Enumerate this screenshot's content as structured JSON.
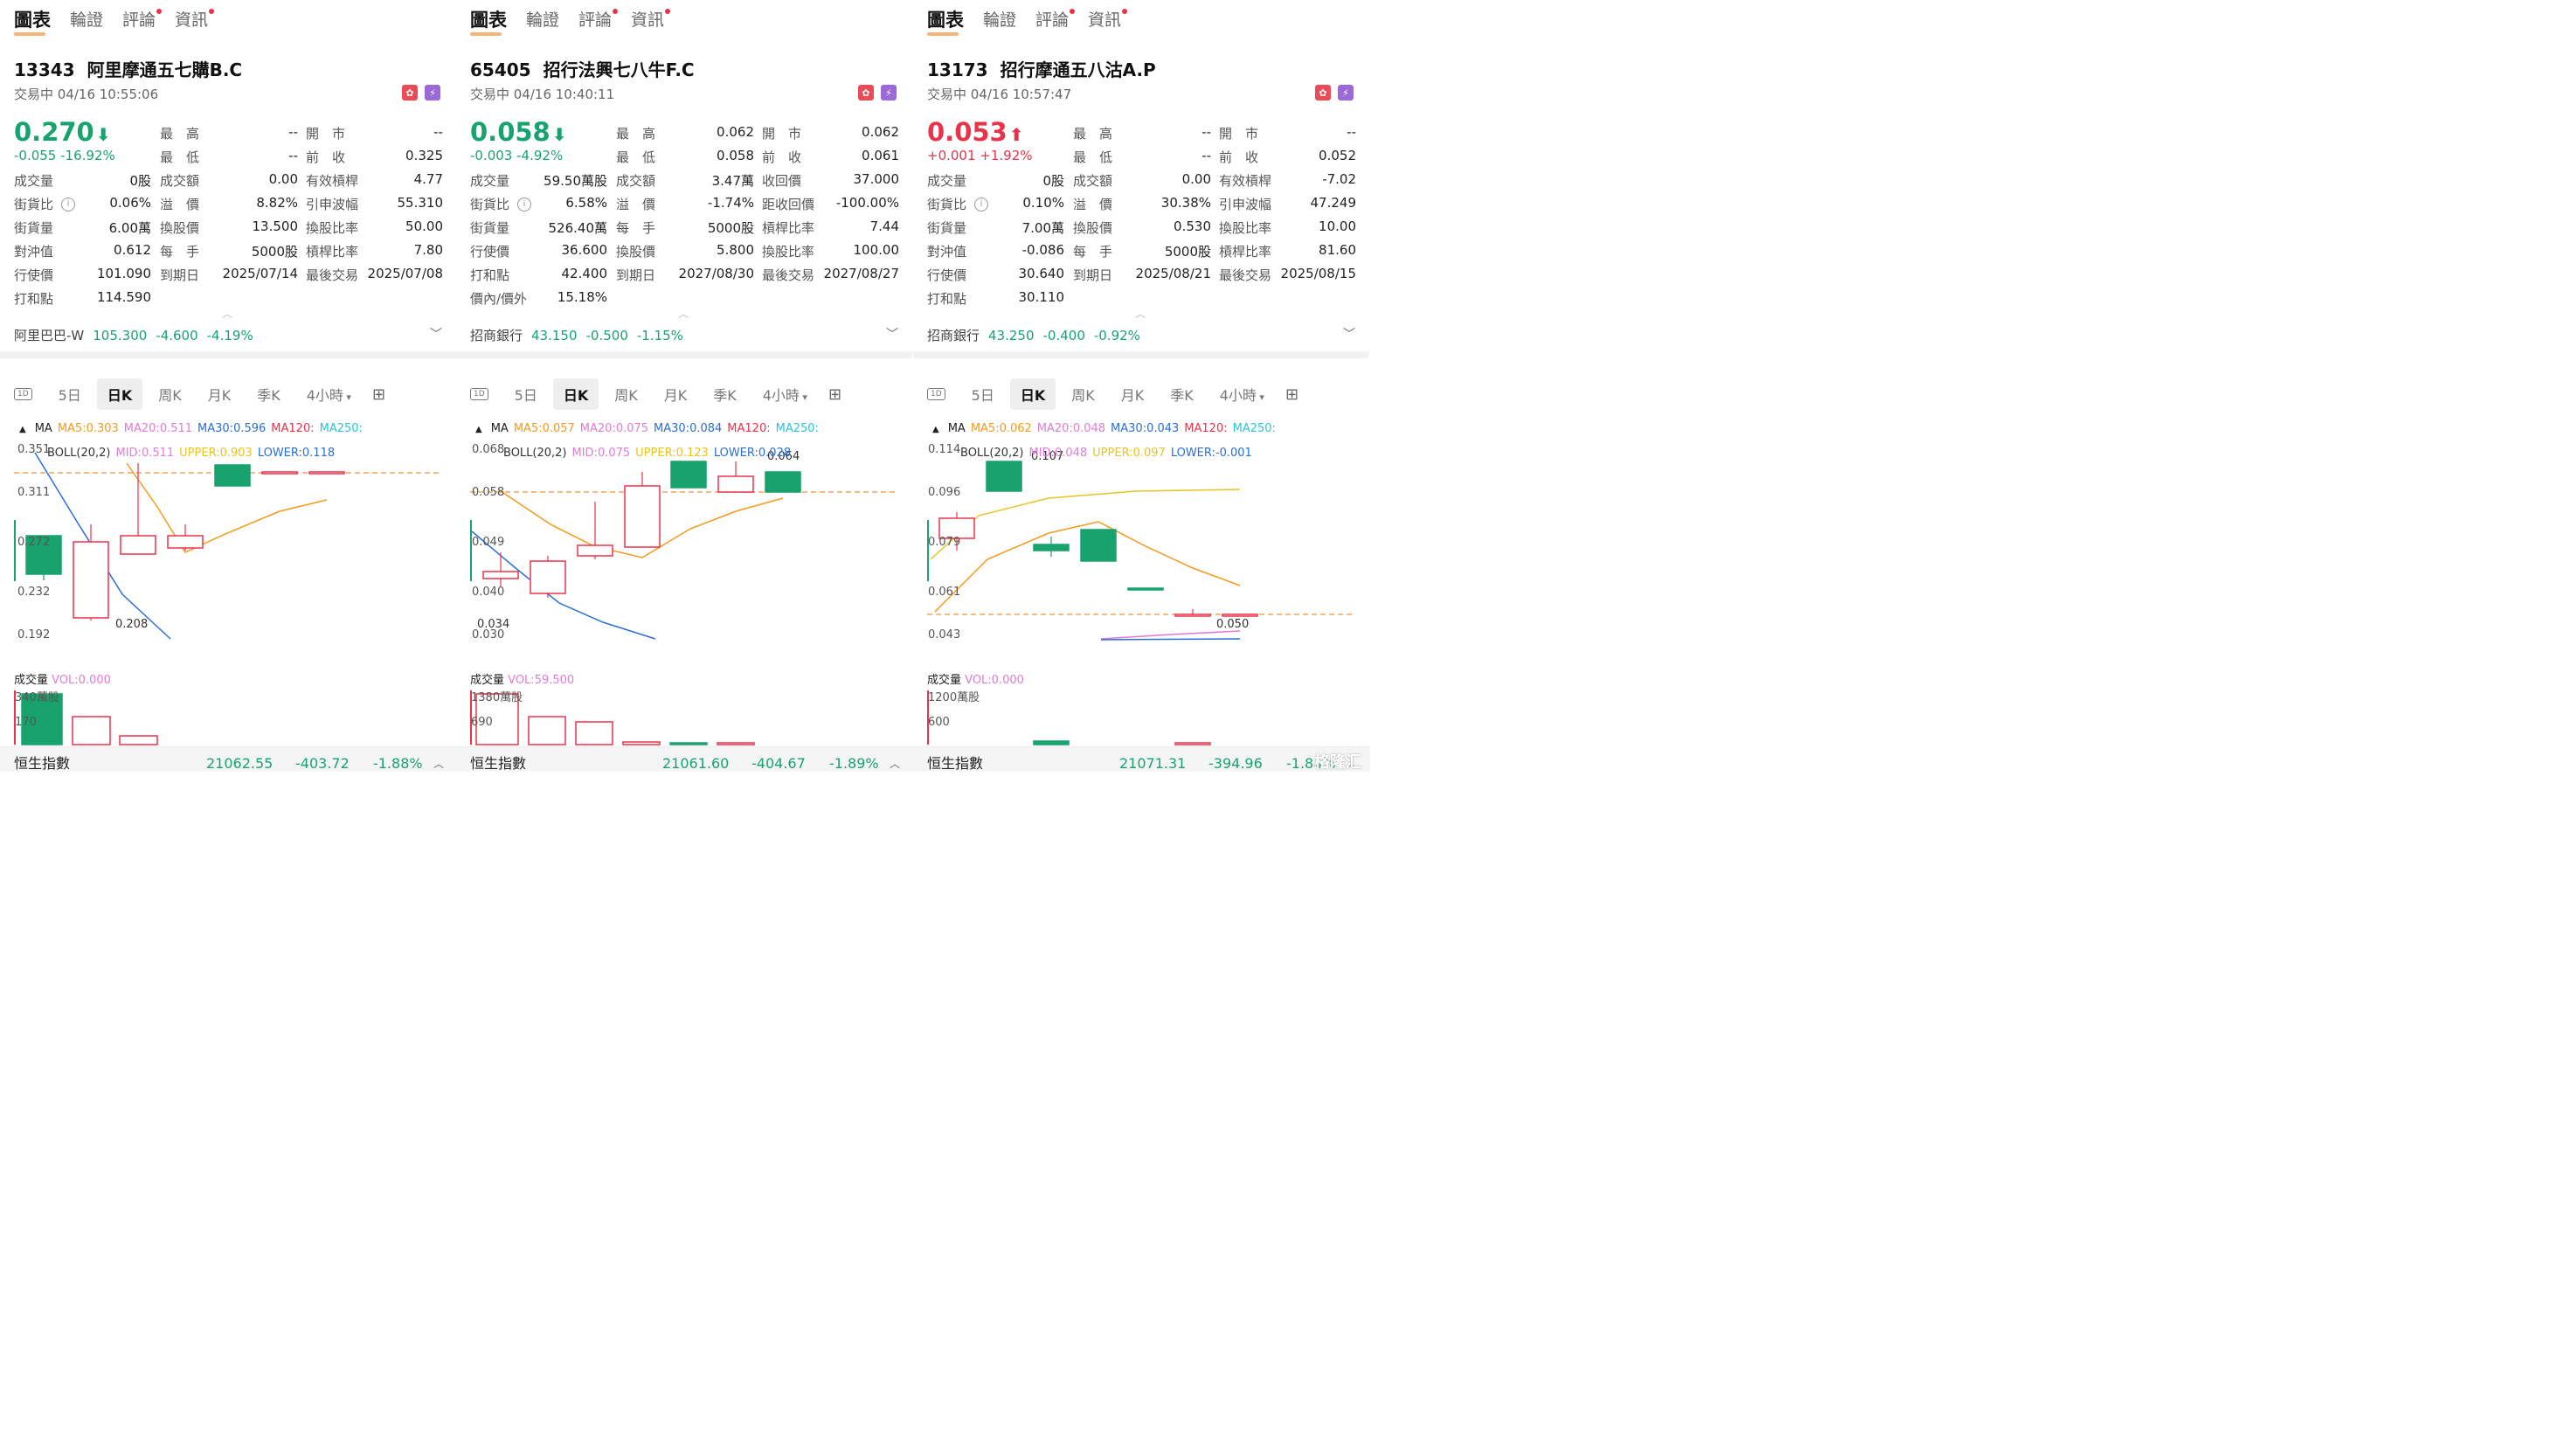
{
  "tabs": [
    "圖表",
    "輪證",
    "評論",
    "資訊"
  ],
  "panels": [
    {
      "code": "13343",
      "name": "阿里摩通五七購B.C",
      "status": "交易中 04/16 10:55:06",
      "price": "0.270",
      "price_arrow": "down",
      "change": "-0.055",
      "change_pct": "-16.92%",
      "trend": "green",
      "quote": [
        {
          "l1": "最　高",
          "v1": "--",
          "l2": "開　市",
          "v2": "--",
          "c1": "",
          "c2": ""
        },
        {
          "l1": "最　低",
          "v1": "--",
          "l2": "前　收",
          "v2": "0.325",
          "c1": "",
          "c2": ""
        },
        {
          "l0": "成交量",
          "v0": "0股",
          "l1": "成交額",
          "v1": "0.00",
          "l2": "有效槓桿",
          "v2": "4.77"
        },
        {
          "l0": "街貨比",
          "v0": "0.06%",
          "l1": "溢　價",
          "v1": "8.82%",
          "l2": "引申波幅",
          "v2": "55.310",
          "info": true
        },
        {
          "l0": "街貨量",
          "v0": "6.00萬",
          "l1": "換股價",
          "v1": "13.500",
          "l2": "換股比率",
          "v2": "50.00"
        },
        {
          "l0": "對沖值",
          "v0": "0.612",
          "l1": "每　手",
          "v1": "5000股",
          "l2": "槓桿比率",
          "v2": "7.80"
        },
        {
          "l0": "行使價",
          "v0": "101.090",
          "l1": "到期日",
          "v1": "2025/07/14",
          "l2": "最後交易",
          "v2": "2025/07/08"
        },
        {
          "l0": "打和點",
          "v0": "114.590",
          "l1": "",
          "v1": "",
          "l2": "",
          "v2": ""
        }
      ],
      "underlying": {
        "name": "阿里巴巴-W",
        "price": "105.300",
        "chg": "-4.600",
        "pct": "-4.19%"
      },
      "ma": {
        "ma5": "MA5:0.303",
        "ma20": "MA20:0.511",
        "ma30": "MA30:0.596",
        "ma120": "MA120:",
        "ma250": "MA250:"
      },
      "boll": {
        "label": "BOLL(20,2)",
        "mid": "MID:0.511",
        "upper": "UPPER:0.903",
        "lower": "LOWER:0.118"
      },
      "yticks": [
        "0.351",
        "0.311",
        "0.272",
        "0.232",
        "0.192"
      ],
      "annot": [
        "0.208"
      ],
      "vol": {
        "label": "成交量",
        "value": "VOL:0.000",
        "t1": "340萬股",
        "t2": "170"
      },
      "footer": {
        "name": "恒生指數",
        "value": "21062.55",
        "chg": "-403.72",
        "pct": "-1.88%"
      }
    },
    {
      "code": "65405",
      "name": "招行法興七八牛F.C",
      "status": "交易中 04/16 10:40:11",
      "price": "0.058",
      "price_arrow": "down",
      "change": "-0.003",
      "change_pct": "-4.92%",
      "trend": "green",
      "quote": [
        {
          "l1": "最　高",
          "v1": "0.062",
          "l2": "開　市",
          "v2": "0.062",
          "c1": "red",
          "c2": "red"
        },
        {
          "l1": "最　低",
          "v1": "0.058",
          "l2": "前　收",
          "v2": "0.061",
          "c1": "green",
          "c2": ""
        },
        {
          "l0": "成交量",
          "v0": "59.50萬股",
          "l1": "成交額",
          "v1": "3.47萬",
          "l2": "收回價",
          "v2": "37.000"
        },
        {
          "l0": "街貨比",
          "v0": "6.58%",
          "l1": "溢　價",
          "v1": "-1.74%",
          "l2": "距收回價",
          "v2": "-100.00%",
          "info": true
        },
        {
          "l0": "街貨量",
          "v0": "526.40萬",
          "l1": "每　手",
          "v1": "5000股",
          "l2": "槓桿比率",
          "v2": "7.44"
        },
        {
          "l0": "行使價",
          "v0": "36.600",
          "l1": "換股價",
          "v1": "5.800",
          "l2": "換股比率",
          "v2": "100.00"
        },
        {
          "l0": "打和點",
          "v0": "42.400",
          "l1": "到期日",
          "v1": "2027/08/30",
          "l2": "最後交易",
          "v2": "2027/08/27"
        },
        {
          "l0": "價內/價外",
          "v0": "15.18%",
          "l1": "",
          "v1": "",
          "l2": "",
          "v2": ""
        }
      ],
      "underlying": {
        "name": "招商銀行",
        "price": "43.150",
        "chg": "-0.500",
        "pct": "-1.15%"
      },
      "ma": {
        "ma5": "MA5:0.057",
        "ma20": "MA20:0.075",
        "ma30": "MA30:0.084",
        "ma120": "MA120:",
        "ma250": "MA250:"
      },
      "boll": {
        "label": "BOLL(20,2)",
        "mid": "MID:0.075",
        "upper": "UPPER:0.123",
        "lower": "LOWER:0.028"
      },
      "yticks": [
        "0.068",
        "0.058",
        "0.049",
        "0.040",
        "0.030"
      ],
      "annot": [
        "0.064",
        "0.034"
      ],
      "vol": {
        "label": "成交量",
        "value": "VOL:59.500",
        "t1": "1380萬股",
        "t2": "690"
      },
      "footer": {
        "name": "恒生指數",
        "value": "21061.60",
        "chg": "-404.67",
        "pct": "-1.89%"
      }
    },
    {
      "code": "13173",
      "name": "招行摩通五八沽A.P",
      "status": "交易中 04/16 10:57:47",
      "price": "0.053",
      "price_arrow": "up",
      "change": "+0.001",
      "change_pct": "+1.92%",
      "trend": "red",
      "quote": [
        {
          "l1": "最　高",
          "v1": "--",
          "l2": "開　市",
          "v2": "--",
          "c1": "",
          "c2": ""
        },
        {
          "l1": "最　低",
          "v1": "--",
          "l2": "前　收",
          "v2": "0.052",
          "c1": "",
          "c2": ""
        },
        {
          "l0": "成交量",
          "v0": "0股",
          "l1": "成交額",
          "v1": "0.00",
          "l2": "有效槓桿",
          "v2": "-7.02"
        },
        {
          "l0": "街貨比",
          "v0": "0.10%",
          "l1": "溢　價",
          "v1": "30.38%",
          "l2": "引申波幅",
          "v2": "47.249",
          "info": true
        },
        {
          "l0": "街貨量",
          "v0": "7.00萬",
          "l1": "換股價",
          "v1": "0.530",
          "l2": "換股比率",
          "v2": "10.00"
        },
        {
          "l0": "對沖值",
          "v0": "-0.086",
          "l1": "每　手",
          "v1": "5000股",
          "l2": "槓桿比率",
          "v2": "81.60"
        },
        {
          "l0": "行使價",
          "v0": "30.640",
          "l1": "到期日",
          "v1": "2025/08/21",
          "l2": "最後交易",
          "v2": "2025/08/15"
        },
        {
          "l0": "打和點",
          "v0": "30.110",
          "l1": "",
          "v1": "",
          "l2": "",
          "v2": ""
        }
      ],
      "underlying": {
        "name": "招商銀行",
        "price": "43.250",
        "chg": "-0.400",
        "pct": "-0.92%"
      },
      "ma": {
        "ma5": "MA5:0.062",
        "ma20": "MA20:0.048",
        "ma30": "MA30:0.043",
        "ma120": "MA120:",
        "ma250": "MA250:"
      },
      "boll": {
        "label": "BOLL(20,2)",
        "mid": "MID:0.048",
        "upper": "UPPER:0.097",
        "lower": "LOWER:-0.001"
      },
      "yticks": [
        "0.114",
        "0.096",
        "0.079",
        "0.061",
        "0.043"
      ],
      "annot": [
        "0.107",
        "0.050"
      ],
      "vol": {
        "label": "成交量",
        "value": "VOL:0.000",
        "t1": "1200萬股",
        "t2": "600"
      },
      "footer": {
        "name": "恒生指數",
        "value": "21071.31",
        "chg": "-394.96",
        "pct": "-1.84%"
      }
    }
  ],
  "chart_tabs": [
    "1D",
    "5日",
    "日K",
    "周K",
    "月K",
    "季K",
    "4小時"
  ],
  "ma_label": "MA",
  "watermark": "格隆汇",
  "colors": {
    "green": "#18a36e",
    "red": "#e8334a",
    "orange": "#f0a35a",
    "ma5": "#f59a1c",
    "ma20": "#e07bd6",
    "ma30": "#2a6fd8",
    "ma120": "#e8334a",
    "ma250": "#29c3d8",
    "boll_upper": "#e8c420",
    "boll_lower": "#2a6fd8"
  }
}
